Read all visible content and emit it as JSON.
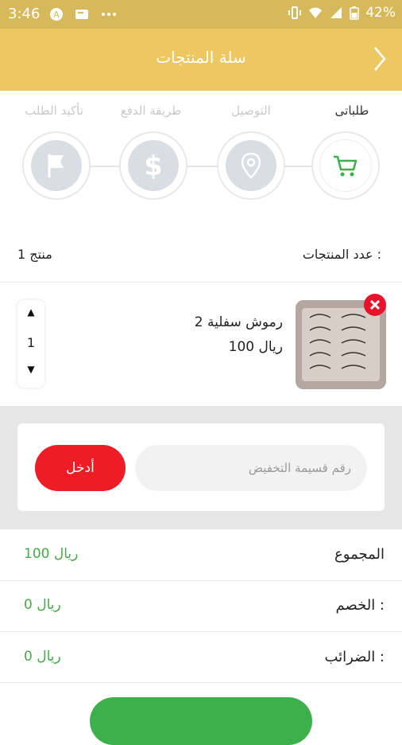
{
  "status_bar": {
    "time": "3:46",
    "battery_percent": "42%",
    "icons": [
      "notification-icon",
      "photo-icon",
      "more-dots-icon",
      "vibrate-icon",
      "wifi-icon",
      "signal-icon",
      "battery-icon"
    ]
  },
  "app_bar": {
    "title": "سلة المنتجات",
    "back_icon": "chevron-right-icon"
  },
  "steps": [
    {
      "label": "طلباتى",
      "icon": "cart-icon",
      "active": true
    },
    {
      "label": "التوصيل",
      "icon": "location-pin-icon",
      "active": false
    },
    {
      "label": "طريقة الدفع",
      "icon": "dollar-icon",
      "active": false
    },
    {
      "label": "تأكيد الطلب",
      "icon": "flag-icon",
      "active": false
    }
  ],
  "product_count": {
    "label": "عدد المنتجات :",
    "value": "1 منتج"
  },
  "product": {
    "name": "رموش سفلية 2",
    "price": "100 ريال",
    "quantity": "1"
  },
  "coupon": {
    "placeholder": "رقم قسيمة التخفيض",
    "apply_label": "أدخل"
  },
  "summary": {
    "total_label": "المجموع",
    "total_value": "100 ريال",
    "discount_label": "الخصم :",
    "discount_value": "0 ريال",
    "tax_label": "الضرائب :",
    "tax_value": "0 ريال"
  },
  "colors": {
    "header": "#ecc762",
    "status_bar": "#d6b95a",
    "accent_green": "#3daf4b",
    "price_green": "#4aa84a",
    "danger_red": "#ee1c25",
    "step_inactive": "#d9dde4"
  }
}
